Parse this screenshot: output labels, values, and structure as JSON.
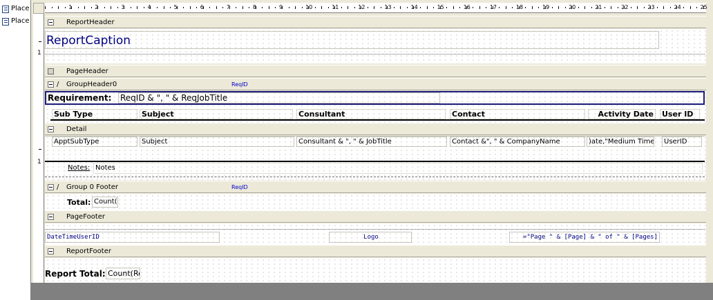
{
  "nav_pane": {
    "items": [
      "Place",
      "Place"
    ]
  },
  "ruler": {
    "numbers": [
      "1",
      "2",
      "3",
      "4",
      "5",
      "6",
      "7",
      "8",
      "9",
      "10",
      "11",
      "12",
      "13",
      "14",
      "15",
      "16",
      "17",
      "18",
      "19",
      "20",
      "21",
      "22",
      "23",
      "24",
      "25"
    ]
  },
  "vruler": {
    "report_header_mark": "1",
    "detail_mark": "1"
  },
  "bands": {
    "report_header": "ReportHeader",
    "page_header": "PageHeader",
    "group_header": "GroupHeader0",
    "detail": "Detail",
    "group_footer": "Group 0 Footer",
    "page_footer": "PageFooter",
    "report_footer": "ReportFooter"
  },
  "group_tags": {
    "header": "ReqID",
    "footer": "ReqID"
  },
  "report_header": {
    "caption": "ReportCaption"
  },
  "group_header": {
    "requirement_label": "Requirement:",
    "requirement_value": "ReqID & \", \" & ReqJobTitle",
    "columns": [
      "Sub Type",
      "Subject",
      "Consultant",
      "Contact",
      "Activity Date",
      "User ID"
    ]
  },
  "detail": {
    "fields": [
      "ApptSubType",
      "Subject",
      "Consultant & \", \" & JobTitle",
      "Contact &\", \" & CompanyName",
      ")ate,\"Medium Time\")",
      "UserID"
    ],
    "notes_label": "Notes:",
    "notes_value": "Notes"
  },
  "group_footer": {
    "total_label": "Total:",
    "total_value": "Count(I"
  },
  "page_footer": {
    "left": "DateTimeUserID",
    "logo": "Logo",
    "page_expr": "=\"Page \" & [Page] & \" of \" & [Pages]"
  },
  "report_footer": {
    "label": "Report Total:",
    "value": "Count(Re"
  },
  "colors": {
    "face": "#ece9d8",
    "caption_blue": "#00007f",
    "section_tag_blue": "#0000cc",
    "status_gray": "#808080"
  }
}
